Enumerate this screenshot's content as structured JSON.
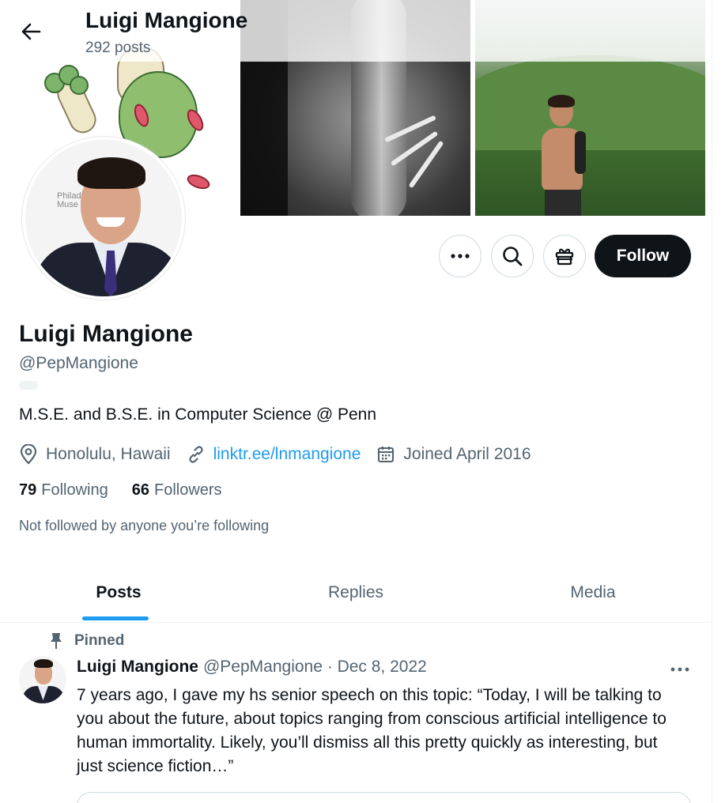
{
  "header": {
    "name": "Luigi Mangione",
    "posts_count": "292 posts"
  },
  "profile": {
    "name": "Luigi Mangione",
    "handle": "@PepMangione",
    "bio": "M.S.E. and B.S.E. in Computer Science @ Penn",
    "location": "Honolulu, Hawaii",
    "link": "linktr.ee/lnmangione",
    "joined": "Joined April 2016",
    "following_count": "79",
    "following_label": "Following",
    "followers_count": "66",
    "followers_label": "Followers",
    "not_followed_text": "Not followed by anyone you’re following",
    "avatar_caption": "Philad\nMuse"
  },
  "actions": {
    "more_icon": "more-horizontal-icon",
    "search_icon": "search-icon",
    "gift_icon": "gift-icon",
    "follow_label": "Follow"
  },
  "tabs": [
    {
      "label": "Posts",
      "active": true
    },
    {
      "label": "Replies",
      "active": false
    },
    {
      "label": "Media",
      "active": false
    }
  ],
  "pinned_post": {
    "pinned_label": "Pinned",
    "author_name": "Luigi Mangione",
    "author_meta": "@PepMangione · Dec 8, 2022",
    "text": "7 years ago, I gave my hs senior speech on this topic: “Today, I will be talking to you about the future, about topics ranging from conscious artificial intelligence to human immortality. Likely, you’ll dismiss all this pretty quickly as interesting, but just science fiction…”"
  },
  "colors": {
    "accent": "#1d9bf0",
    "text_primary": "#0f1419",
    "text_secondary": "#536471",
    "follow_bg": "#0f1419"
  }
}
